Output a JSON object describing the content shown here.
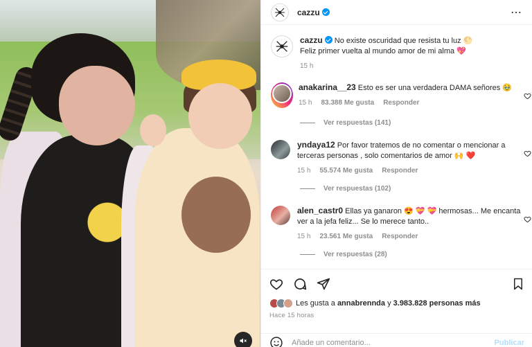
{
  "post": {
    "author": "cazzu",
    "caption_line1": "No existe oscuridad que resista tu luz",
    "caption_line2": "Feliz primer vuelta al mundo amor de mi alma",
    "caption_time": "15 h",
    "more_icon": "⋯"
  },
  "comments": [
    {
      "username": "anakarina__23",
      "text": "Esto es ser una verdadera DAMA señores 🥹",
      "time": "15 h",
      "likes": "83.388 Me gusta",
      "reply_label": "Responder",
      "replies": "Ver respuestas (141)"
    },
    {
      "username": "yndaya12",
      "text": "Por favor tratemos de no comentar o mencionar a terceras personas , solo comentarios de amor 🙌 ❤️",
      "time": "15 h",
      "likes": "55.574 Me gusta",
      "reply_label": "Responder",
      "replies": "Ver respuestas (102)"
    },
    {
      "username": "alen_castr0",
      "text": "Ellas ya ganaron 😍 💝 💝 hermosas... Me encanta ver a la jefa feliz... Se lo merece tanto..",
      "time": "15 h",
      "likes": "23.561 Me gusta",
      "reply_label": "Responder",
      "replies": "Ver respuestas (28)"
    }
  ],
  "likes_bar": {
    "prefix": "Les gusta a",
    "first_user": "annabrennda",
    "connector": "y",
    "others": "3.983.828 personas más"
  },
  "time_ago": "Hace 15 horas",
  "add_comment": {
    "placeholder": "Añade un comentario...",
    "publish_label": "Publicar"
  },
  "colors": {
    "verified": "#0095f6",
    "publish_disabled": "#b2dffc",
    "secondary_text": "#8e8e8e"
  },
  "icons": [
    "spider-avatar-icon",
    "verified-icon",
    "more-options-icon",
    "heart-icon",
    "comment-icon",
    "share-icon",
    "save-icon",
    "emoji-icon",
    "mute-icon"
  ]
}
